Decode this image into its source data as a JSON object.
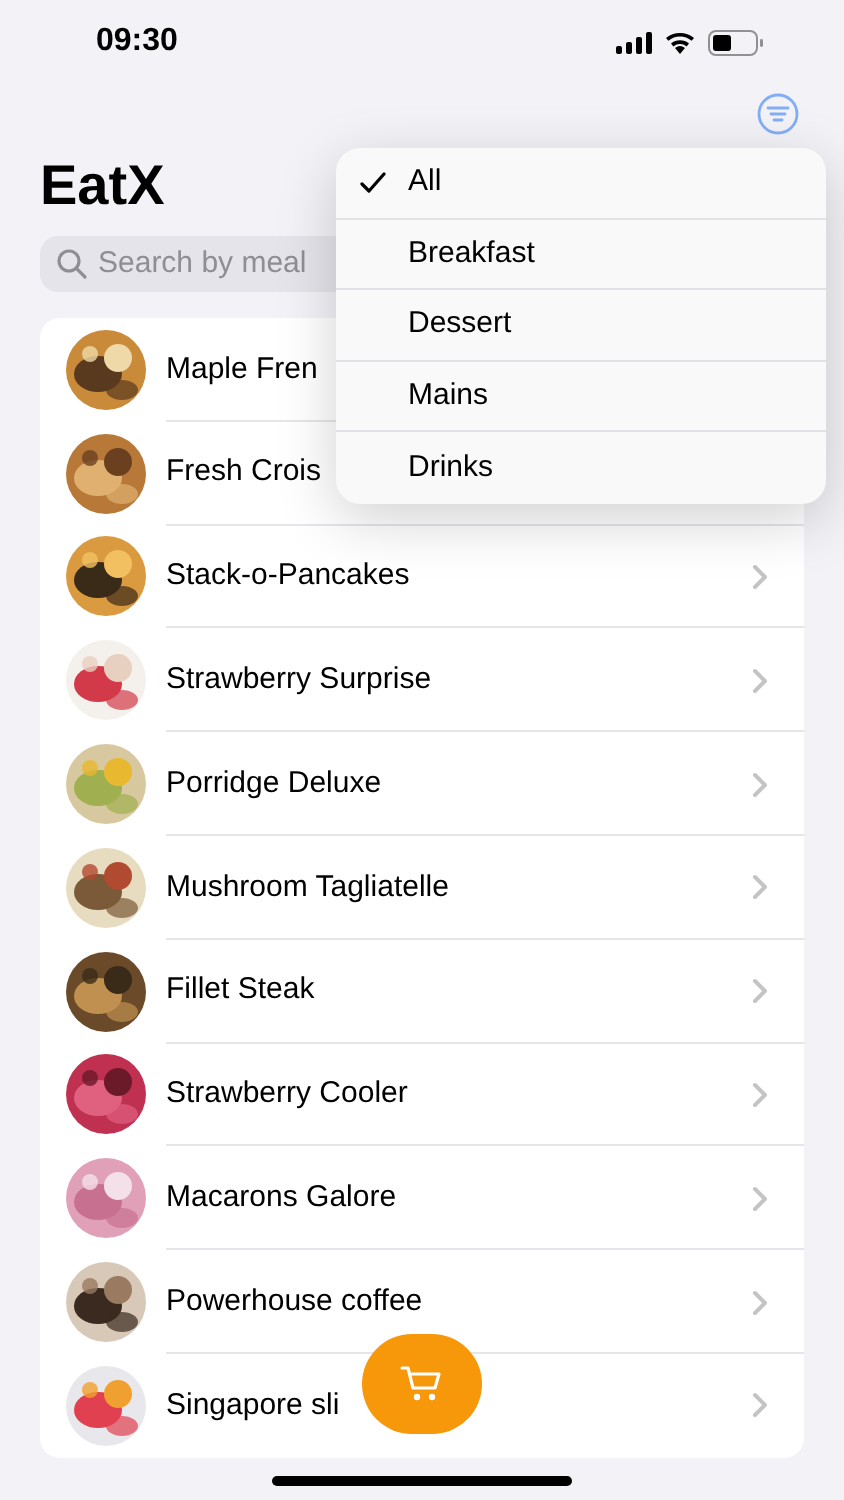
{
  "status_bar": {
    "time": "09:30"
  },
  "title": "EatX",
  "search": {
    "placeholder": "Search by meal"
  },
  "meals": [
    {
      "name": "Maple Fren",
      "chevron": false
    },
    {
      "name": "Fresh Crois",
      "chevron": false
    },
    {
      "name": "Stack-o-Pancakes",
      "chevron": true
    },
    {
      "name": "Strawberry Surprise",
      "chevron": true
    },
    {
      "name": "Porridge Deluxe",
      "chevron": true
    },
    {
      "name": "Mushroom Tagliatelle",
      "chevron": true
    },
    {
      "name": "Fillet Steak",
      "chevron": true
    },
    {
      "name": "Strawberry Cooler",
      "chevron": true
    },
    {
      "name": "Macarons Galore",
      "chevron": true
    },
    {
      "name": "Powerhouse coffee",
      "chevron": true
    },
    {
      "name": "Singapore sli",
      "chevron": true
    }
  ],
  "filter_menu": [
    {
      "label": "All",
      "selected": true
    },
    {
      "label": "Breakfast",
      "selected": false
    },
    {
      "label": "Dessert",
      "selected": false
    },
    {
      "label": "Mains",
      "selected": false
    },
    {
      "label": "Drinks",
      "selected": false
    }
  ]
}
